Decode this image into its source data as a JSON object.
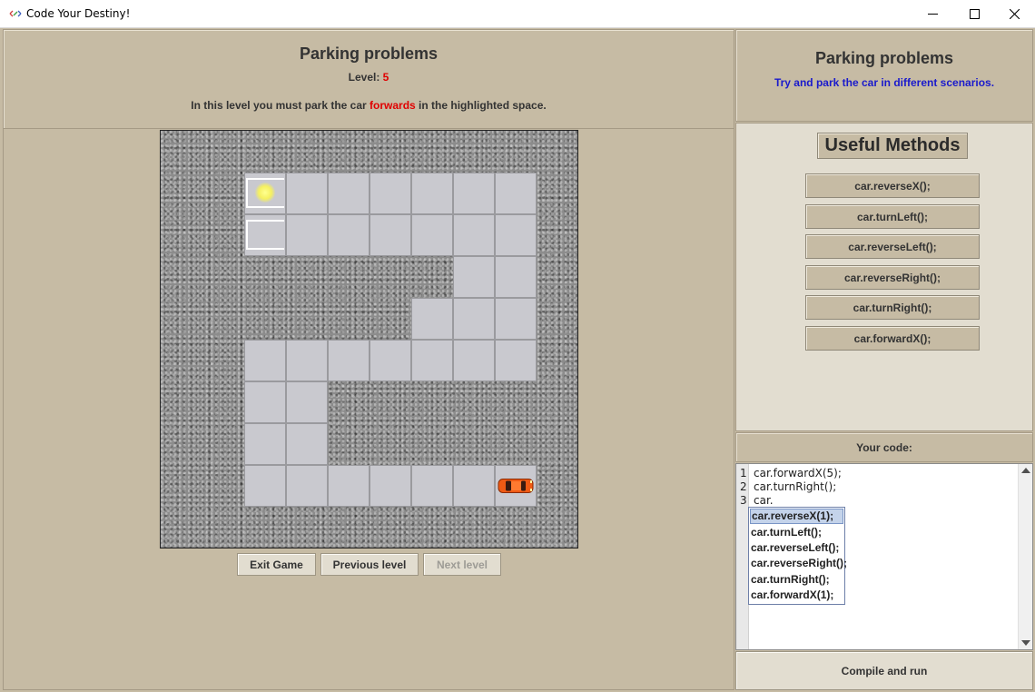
{
  "window": {
    "title": "Code Your Destiny!"
  },
  "level_header": {
    "title": "Parking problems",
    "level_label": "Level: ",
    "level_number": "5",
    "instruction_before": "In this level you must park the car ",
    "instruction_highlight": "forwards",
    "instruction_after": " in the highlighted space."
  },
  "game": {
    "buttons": {
      "exit": "Exit Game",
      "previous": "Previous level",
      "next": "Next level"
    },
    "next_enabled": false,
    "road_tiles": [
      [
        2,
        1
      ],
      [
        3,
        1
      ],
      [
        4,
        1
      ],
      [
        5,
        1
      ],
      [
        6,
        1
      ],
      [
        7,
        1
      ],
      [
        8,
        1
      ],
      [
        2,
        2
      ],
      [
        3,
        2
      ],
      [
        4,
        2
      ],
      [
        5,
        2
      ],
      [
        6,
        2
      ],
      [
        7,
        2
      ],
      [
        8,
        2
      ],
      [
        7,
        3
      ],
      [
        8,
        3
      ],
      [
        6,
        4
      ],
      [
        7,
        4
      ],
      [
        8,
        4
      ],
      [
        2,
        5
      ],
      [
        3,
        5
      ],
      [
        4,
        5
      ],
      [
        5,
        5
      ],
      [
        6,
        5
      ],
      [
        7,
        5
      ],
      [
        8,
        5
      ],
      [
        2,
        6
      ],
      [
        3,
        6
      ],
      [
        2,
        7
      ],
      [
        3,
        7
      ],
      [
        2,
        8
      ],
      [
        3,
        8
      ],
      [
        4,
        8
      ],
      [
        5,
        8
      ],
      [
        6,
        8
      ],
      [
        7,
        8
      ],
      [
        8,
        8
      ]
    ],
    "parking_spots": [
      [
        2,
        1
      ],
      [
        2,
        2
      ]
    ],
    "highlighted_spot": [
      2,
      1
    ],
    "car": {
      "color": "#f05a14",
      "cell": [
        8,
        8
      ],
      "facing": "right"
    }
  },
  "info_panel": {
    "title": "Parking problems",
    "subtitle": "Try and park the car in different scenarios."
  },
  "methods": {
    "title": "Useful Methods",
    "items": [
      "car.reverseX();",
      "car.turnLeft();",
      "car.reverseLeft();",
      "car.reverseRight();",
      "car.turnRight();",
      "car.forwardX();"
    ]
  },
  "editor": {
    "label": "Your code:",
    "line_numbers": [
      "1",
      "2",
      "3"
    ],
    "lines": [
      "car.forwardX(5);",
      "car.turnRight();",
      "car."
    ],
    "autocomplete": [
      "car.reverseX(1);",
      "car.turnLeft();",
      "car.reverseLeft();",
      "car.reverseRight();",
      "car.turnRight();",
      "car.forwardX(1);"
    ],
    "autocomplete_selected": 0
  },
  "compile_button": "Compile and run"
}
